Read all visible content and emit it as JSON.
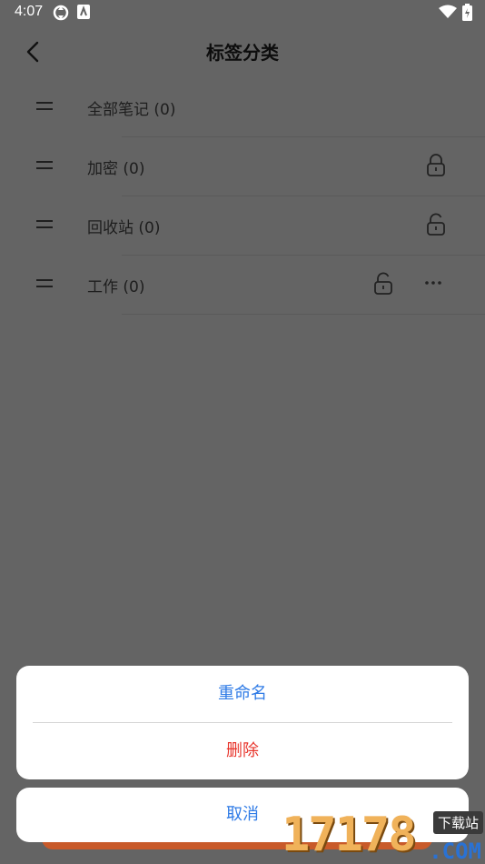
{
  "status_bar": {
    "time": "4:07"
  },
  "header": {
    "title": "标签分类"
  },
  "tags": [
    {
      "label": "全部笔记 (0)",
      "lock": "none",
      "more": false
    },
    {
      "label": "加密 (0)",
      "lock": "locked",
      "more": false
    },
    {
      "label": "回收站 (0)",
      "lock": "unlocked",
      "more": false
    },
    {
      "label": "工作 (0)",
      "lock": "unlocked",
      "more": true
    }
  ],
  "action_sheet": {
    "rename_label": "重命名",
    "delete_label": "删除",
    "cancel_label": "取消"
  },
  "watermark": {
    "number": "17178",
    "badge": "下载站",
    "domain": ".COM"
  },
  "colors": {
    "accent_blue": "#2f7be6",
    "danger_red": "#e8352c",
    "overlay": "#646464"
  }
}
